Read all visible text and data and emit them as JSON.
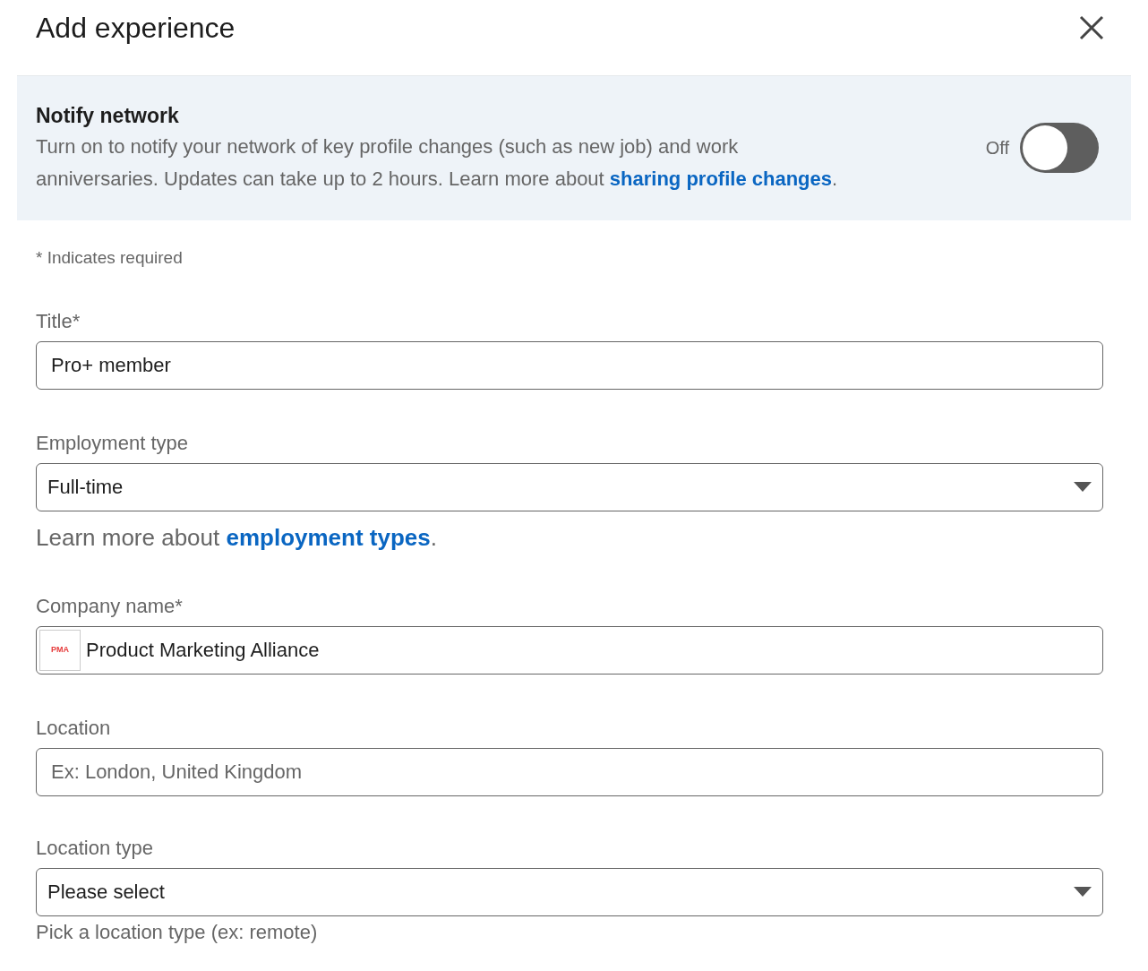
{
  "dialog": {
    "title": "Add experience"
  },
  "notify": {
    "title": "Notify network",
    "text": "Turn on to notify your network of key profile changes (such as new job) and work anniversaries. Updates can take up to 2 hours. Learn more about ",
    "link": "sharing profile changes",
    "suffix": ".",
    "toggle_label": "Off",
    "on": false
  },
  "required_note": "* Indicates required",
  "fields": [
    {
      "kind": "text",
      "label": "Title*",
      "value": "Pro+ member"
    },
    {
      "kind": "select",
      "label": "Employment type",
      "value": "Full-time",
      "helper": {
        "text": "Learn more about ",
        "link": "employment types",
        "suffix": "."
      }
    },
    {
      "kind": "company",
      "label": "Company name*",
      "value": "Product Marketing Alliance",
      "logo": "PMA"
    },
    {
      "kind": "text",
      "label": "Location",
      "placeholder": "Ex: London, United Kingdom"
    },
    {
      "kind": "select",
      "label": "Location type",
      "value": "Please select",
      "note": "Pick a location type (ex: remote)"
    }
  ]
}
